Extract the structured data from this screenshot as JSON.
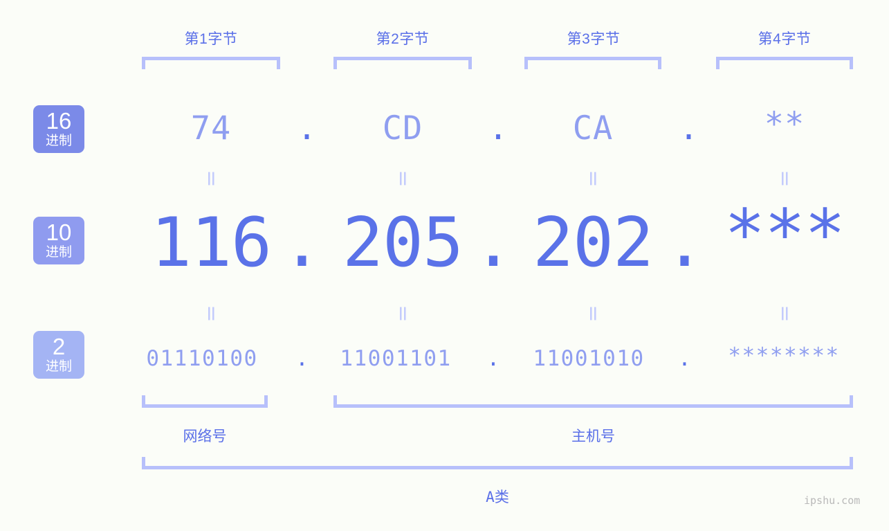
{
  "watermark": "ipshu.com",
  "colors": {
    "background": "#fbfdf8",
    "accent_strong": "#5a72e8",
    "accent_mid": "#8f9ef0",
    "accent_light": "#b7c0fb",
    "label_blue": "#5a6fe8",
    "badge_hex": "#7b8ae8",
    "badge_dec": "#8f9bef",
    "badge_bin": "#a4b4f4"
  },
  "byte_headers": [
    {
      "label": "第1字节"
    },
    {
      "label": "第2字节"
    },
    {
      "label": "第3字节"
    },
    {
      "label": "第4字节"
    }
  ],
  "rows": [
    {
      "key": "hex",
      "badge": {
        "number": "16",
        "suffix": "进制",
        "color": "#7b8ae8"
      },
      "values": [
        "74",
        "CD",
        "CA",
        "**"
      ],
      "separator": "."
    },
    {
      "key": "dec",
      "badge": {
        "number": "10",
        "suffix": "进制",
        "color": "#8f9bef"
      },
      "values": [
        "116",
        "205",
        "202",
        "***"
      ],
      "separator": "."
    },
    {
      "key": "bin",
      "badge": {
        "number": "2",
        "suffix": "进制",
        "color": "#a4b4f4"
      },
      "values": [
        "01110100",
        "11001101",
        "11001010",
        "********"
      ],
      "separator": "."
    }
  ],
  "equals": {
    "symbol": "=",
    "hex_to_dec": [
      "=",
      "=",
      "=",
      "="
    ],
    "dec_to_bin": [
      "=",
      "=",
      "=",
      "="
    ]
  },
  "groups": [
    {
      "label": "网络号",
      "spans": "第1字节"
    },
    {
      "label": "主机号",
      "spans": "第2字节-第4字节"
    }
  ],
  "ip_class": {
    "label": "A类"
  }
}
